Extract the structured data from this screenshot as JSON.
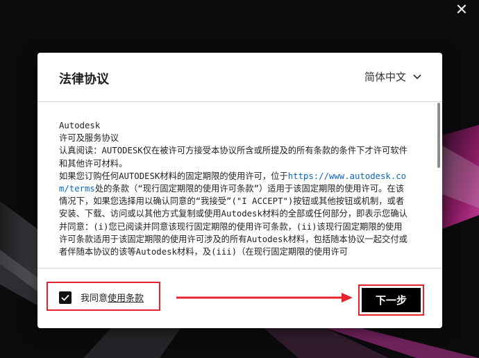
{
  "window": {
    "close_glyph": "✕"
  },
  "dialog": {
    "title": "法律协议",
    "language": {
      "selected": "简体中文"
    }
  },
  "agreement": {
    "paragraphs": [
      "Autodesk",
      "许可及服务协议",
      "认真阅读：AUTODESK仅在被许可方接受本协议所含或所提及的所有条款的条件下才许可软件和其他许可材料。"
    ],
    "p4_before_link": "如果您订购任何AUTODESK材料的固定期限的使用许可，位于",
    "link": "https://www.autodesk.com/terms",
    "p4_after_link": "处的条款（“现行固定期限的使用许可条款”）适用于该固定期限的使用许可。在该情况下，如果您选择用以确认同意的“我接受”(\"I ACCEPT\")按钮或其他按钮或机制，或者安装、下载、访问或以其他方式复制或使用Autodesk材料的全部或任何部分，即表示您确认并同意：(i)您已阅读并同意该现行固定期限的使用许可条款，(ii)该现行固定期限的使用许可条款适用于该固定期限的使用许可涉及的所有Autodesk材料，包括随本协议一起交付或者伴随本协议的该等Autodesk材料，及(iii)（在现行固定期限的使用许可"
  },
  "footer": {
    "agree_prefix": "我同意",
    "agree_link": "使用条款",
    "checkbox_checked": true,
    "next_label": "下一步"
  },
  "colors": {
    "highlight": "#e5232d",
    "button_bg": "#000000",
    "link": "#0a66c2"
  }
}
